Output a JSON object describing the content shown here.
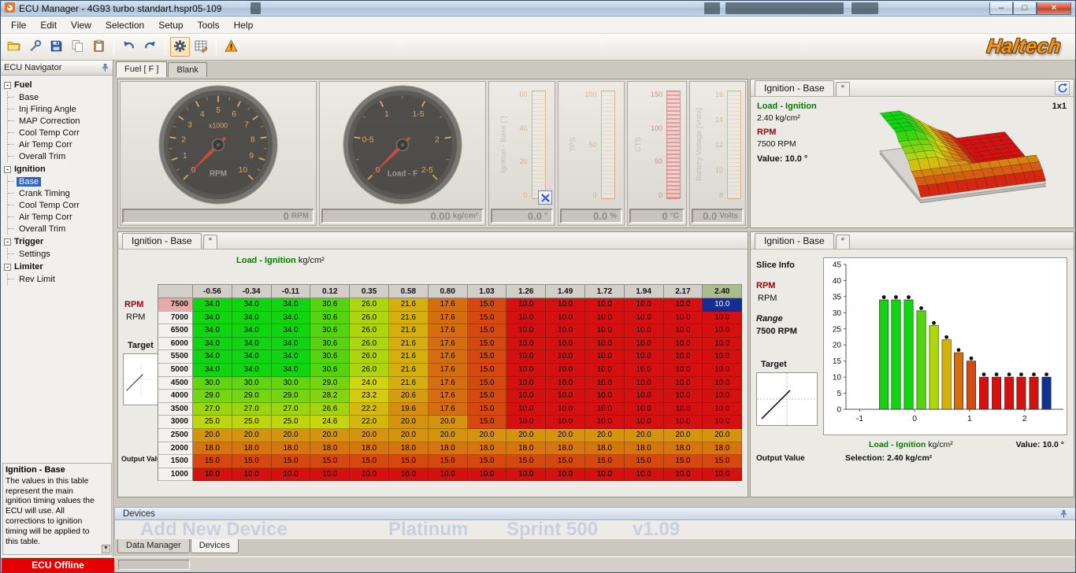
{
  "window": {
    "title": "ECU Manager - 4G93 turbo standart.hspr05-109",
    "controls": {
      "minimize": "–",
      "maximize": "□",
      "close": "×"
    }
  },
  "menu": {
    "items": [
      "File",
      "Edit",
      "View",
      "Selection",
      "Setup",
      "Tools",
      "Help"
    ]
  },
  "toolbar": {
    "buttons": [
      "open-folder",
      "connect-tool",
      "save",
      "copy",
      "paste",
      "sep",
      "undo",
      "redo",
      "sep",
      "settings-gear",
      "table-edit",
      "sep",
      "warning"
    ],
    "brand": "Haltech"
  },
  "navigator": {
    "title": "ECU Navigator",
    "tree": [
      {
        "label": "Fuel",
        "children": [
          "Base",
          "Inj Firing Angle",
          "MAP Correction",
          "Cool Temp Corr",
          "Air Temp Corr",
          "Overall Trim"
        ]
      },
      {
        "label": "Ignition",
        "children": [
          "Base",
          "Crank Timing",
          "Cool Temp Corr",
          "Air Temp Corr",
          "Overall Trim"
        ]
      },
      {
        "label": "Trigger",
        "children": [
          "Settings"
        ]
      },
      {
        "label": "Limiter",
        "children": [
          "Rev Limit"
        ]
      }
    ],
    "selected": {
      "group": "Ignition",
      "item": "Base"
    },
    "info_title": "Ignition - Base",
    "info_body": "The values in this table represent the main ignition timing values the ECU will use. All corrections to ignition timing will be applied to this table."
  },
  "main_tabs": {
    "tabs": [
      "Fuel [ F ]",
      "Blank"
    ],
    "active": 0
  },
  "gauges": {
    "rpm": {
      "caption": "RPM",
      "multiplier": "x1000",
      "max": 10,
      "labels": [
        "0",
        "1",
        "2",
        "3",
        "4",
        "5",
        "6",
        "7",
        "8",
        "9",
        "10"
      ],
      "label_values": [
        0,
        1,
        2,
        3,
        4,
        5,
        6,
        7,
        8,
        9,
        10
      ],
      "minor_step": 0.5,
      "readout_value": "0",
      "readout_unit": "RPM"
    },
    "load": {
      "caption": "Load - F",
      "max": 2.5,
      "labels": [
        "0",
        "0-5",
        "1",
        "1-5",
        "2",
        "2-5"
      ],
      "label_values": [
        0,
        0.5,
        1,
        1.5,
        2,
        2.5
      ],
      "minor_step": 0.25,
      "readout_value": "0.00",
      "readout_unit": "kg/cm²"
    },
    "bars": [
      {
        "label": "Ignition - Base [°]",
        "ticks": [
          "60",
          "40",
          "20",
          "0"
        ],
        "readout_value": "0.0",
        "readout_unit": "°",
        "alarm": false,
        "has_tool": true
      },
      {
        "label": "TPS",
        "ticks": [
          "100",
          "50",
          "0"
        ],
        "readout_value": "0.0",
        "readout_unit": "%",
        "alarm": false,
        "has_tool": false
      },
      {
        "label": "CTS",
        "ticks": [
          "150",
          "100",
          "50",
          "0"
        ],
        "readout_value": "0",
        "readout_unit": "°C",
        "alarm": true,
        "has_tool": false
      },
      {
        "label": "Battery Voltage [Volts]",
        "ticks": [
          "16",
          "14",
          "12",
          "10",
          "8"
        ],
        "readout_value": "0.0",
        "readout_unit": "Volts",
        "alarm": false,
        "has_tool": false
      }
    ]
  },
  "surface_panel": {
    "tab": "Ignition - Base",
    "deg_tab": "°",
    "load_label": "Load - Ignition",
    "load_value": "2.40 kg/cm²",
    "rpm_label": "RPM",
    "rpm_value": "7500 RPM",
    "value_label": "Value:",
    "value_text": "10.0 °",
    "grid_label": "1x1"
  },
  "table_panel": {
    "tab": "Ignition - Base",
    "deg_tab": "°",
    "axis_label": "Load - Ignition",
    "axis_unit": "kg/cm²",
    "row_axis_label": "RPM",
    "row_axis_unit": "RPM",
    "target_label": "Target",
    "output_label": "Output Value",
    "col_headers": [
      "-0.56",
      "-0.34",
      "-0.11",
      "0.12",
      "0.35",
      "0.58",
      "0.80",
      "1.03",
      "1.26",
      "1.49",
      "1.72",
      "1.94",
      "2.17",
      "2.40"
    ],
    "row_headers": [
      "7500",
      "7000",
      "6500",
      "6000",
      "5500",
      "5000",
      "4500",
      "4000",
      "3500",
      "3000",
      "2500",
      "2000",
      "1500",
      "1000"
    ],
    "rows": [
      [
        34.0,
        34.0,
        34.0,
        30.6,
        26.0,
        21.6,
        17.6,
        15.0,
        10.0,
        10.0,
        10.0,
        10.0,
        10.0,
        10.0
      ],
      [
        34.0,
        34.0,
        34.0,
        30.6,
        26.0,
        21.6,
        17.6,
        15.0,
        10.0,
        10.0,
        10.0,
        10.0,
        10.0,
        10.0
      ],
      [
        34.0,
        34.0,
        34.0,
        30.6,
        26.0,
        21.6,
        17.6,
        15.0,
        10.0,
        10.0,
        10.0,
        10.0,
        10.0,
        10.0
      ],
      [
        34.0,
        34.0,
        34.0,
        30.6,
        26.0,
        21.6,
        17.6,
        15.0,
        10.0,
        10.0,
        10.0,
        10.0,
        10.0,
        10.0
      ],
      [
        34.0,
        34.0,
        34.0,
        30.6,
        26.0,
        21.6,
        17.6,
        15.0,
        10.0,
        10.0,
        10.0,
        10.0,
        10.0,
        10.0
      ],
      [
        34.0,
        34.0,
        34.0,
        30.6,
        26.0,
        21.6,
        17.6,
        15.0,
        10.0,
        10.0,
        10.0,
        10.0,
        10.0,
        10.0
      ],
      [
        30.0,
        30.0,
        30.0,
        29.0,
        24.0,
        21.6,
        17.6,
        15.0,
        10.0,
        10.0,
        10.0,
        10.0,
        10.0,
        10.0
      ],
      [
        29.0,
        29.0,
        29.0,
        28.2,
        23.2,
        20.6,
        17.6,
        15.0,
        10.0,
        10.0,
        10.0,
        10.0,
        10.0,
        10.0
      ],
      [
        27.0,
        27.0,
        27.0,
        26.6,
        22.2,
        19.6,
        17.6,
        15.0,
        10.0,
        10.0,
        10.0,
        10.0,
        10.0,
        10.0
      ],
      [
        25.0,
        25.0,
        25.0,
        24.6,
        22.0,
        20.0,
        20.0,
        15.0,
        10.0,
        10.0,
        10.0,
        10.0,
        10.0,
        10.0
      ],
      [
        20.0,
        20.0,
        20.0,
        20.0,
        20.0,
        20.0,
        20.0,
        20.0,
        20.0,
        20.0,
        20.0,
        20.0,
        20.0,
        20.0
      ],
      [
        18.0,
        18.0,
        18.0,
        18.0,
        18.0,
        18.0,
        18.0,
        18.0,
        18.0,
        18.0,
        18.0,
        18.0,
        18.0,
        18.0
      ],
      [
        15.0,
        15.0,
        15.0,
        15.0,
        15.0,
        15.0,
        15.0,
        15.0,
        15.0,
        15.0,
        15.0,
        15.0,
        15.0,
        15.0
      ],
      [
        10.0,
        10.0,
        10.0,
        10.0,
        10.0,
        10.0,
        10.0,
        10.0,
        10.0,
        10.0,
        10.0,
        10.0,
        10.0,
        10.0
      ]
    ],
    "selected_cell": {
      "row": 0,
      "col": 13
    },
    "value_min": 10,
    "value_max": 34
  },
  "slice_panel": {
    "tab": "Ignition - Base",
    "deg_tab": "°",
    "slice_info_label": "Slice Info",
    "rpm_label": "RPM",
    "rpm_unit": "RPM",
    "range_label": "Range",
    "range_value": "7500 RPM",
    "target_label": "Target",
    "output_label": "Output Value",
    "axis_label": "Load - Ignition",
    "axis_unit": "kg/cm²",
    "value_label": "Value:",
    "value_text": "10.0 °",
    "selection_label": "Selection:",
    "selection_value": "2.40 kg/cm²",
    "chart": {
      "type": "bar",
      "y_ticks": [
        0,
        5,
        10,
        15,
        20,
        25,
        30,
        35,
        40,
        45
      ],
      "x_ticks": [
        "-1",
        "0",
        "1",
        "2"
      ],
      "ylim": [
        0,
        45
      ]
    }
  },
  "devices_panel": {
    "title": "Devices",
    "watermark": [
      "Add New Device",
      "Platinum",
      "Sprint 500",
      "v1.09"
    ],
    "tabs": [
      "Data Manager",
      "Devices"
    ],
    "active_tab": 1
  },
  "status": {
    "ecu": "ECU Offline"
  },
  "colors": {
    "accent_green": "#007d00",
    "accent_maroon": "#96000a",
    "selected_cell": "#122f96",
    "brand_orange": "#f7941d",
    "status_red": "#e40000"
  }
}
